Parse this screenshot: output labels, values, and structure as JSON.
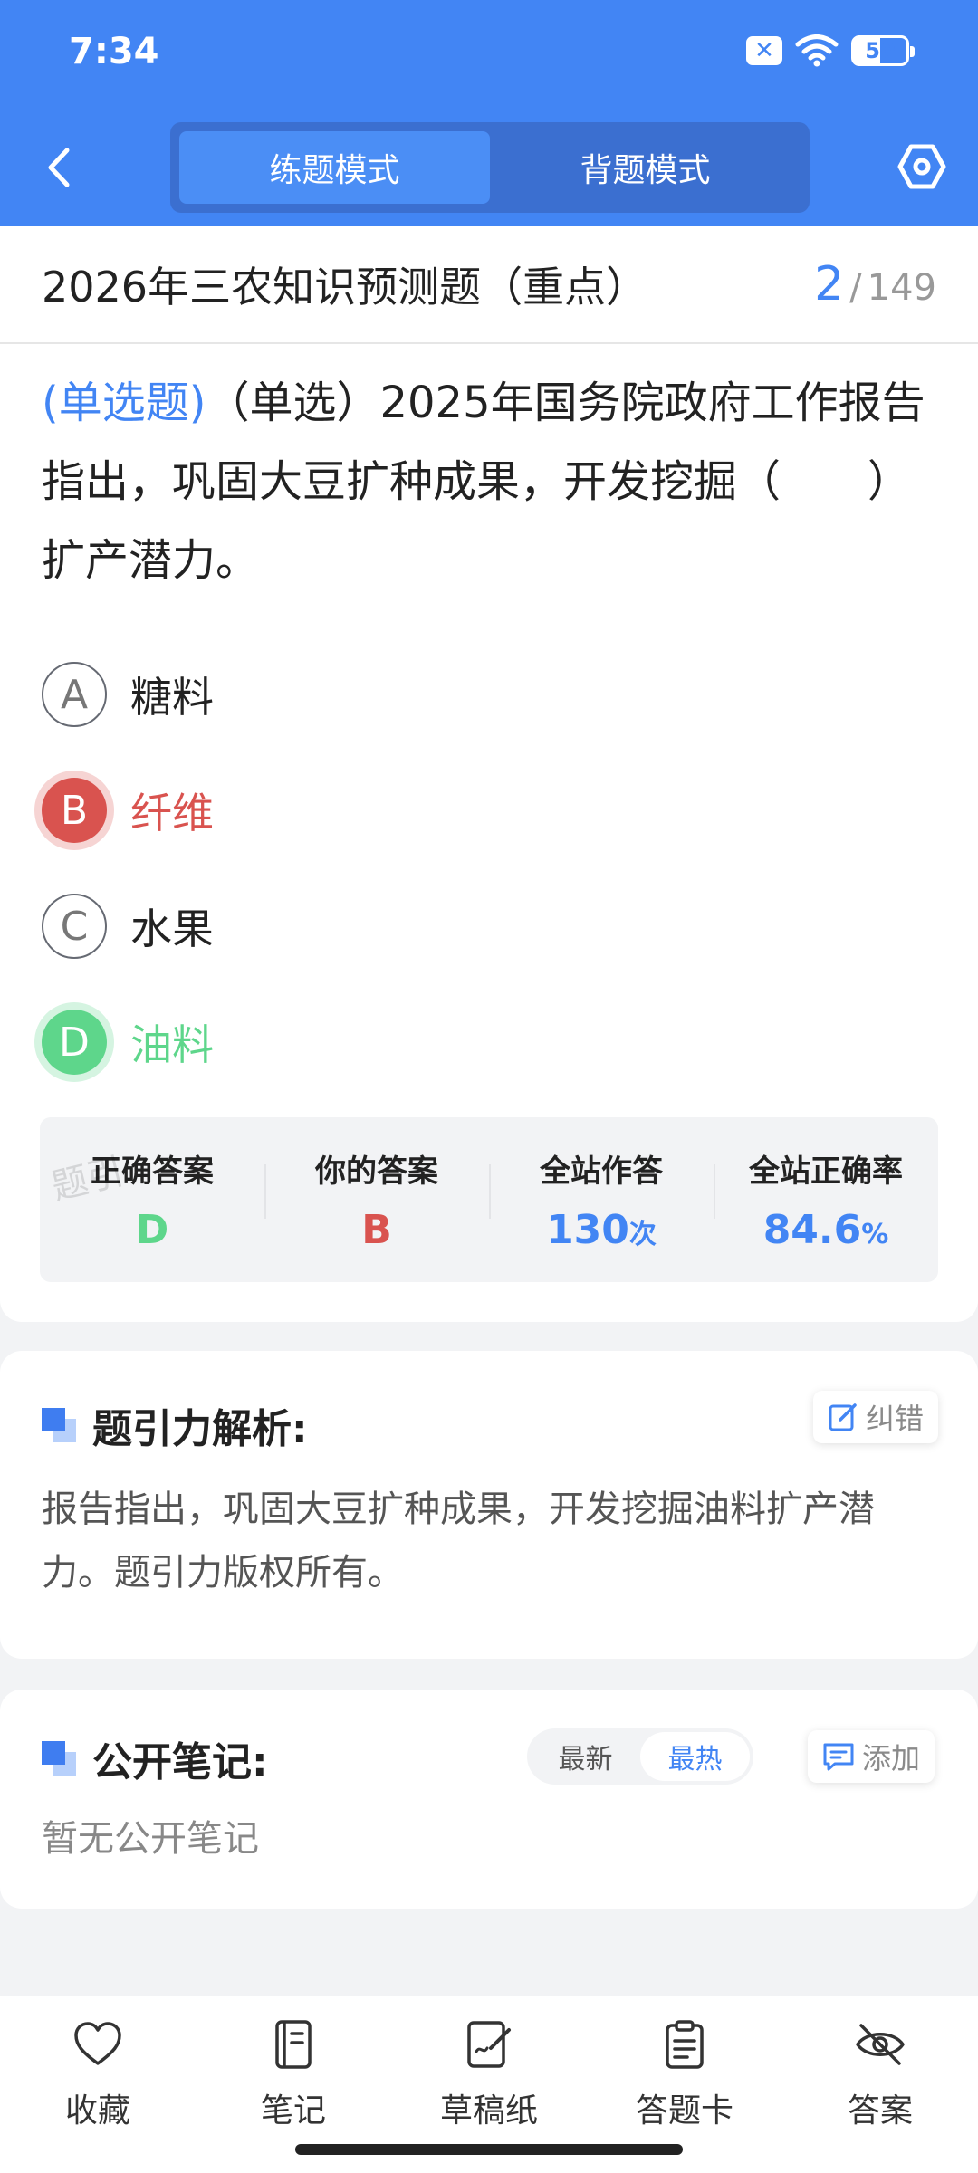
{
  "status_bar": {
    "time": "7:34",
    "battery": "50"
  },
  "header": {
    "modes": [
      {
        "label": "练题模式",
        "active": true
      },
      {
        "label": "背题模式",
        "active": false
      }
    ]
  },
  "exam": {
    "title": "2026年三农知识预测题（重点）",
    "current": "2",
    "separator": "/",
    "total": "149"
  },
  "question": {
    "type_label": "(单选题)",
    "text": "（单选）2025年国务院政府工作报告指出，巩固大豆扩种成果，开发挖掘（　　）扩产潜力。"
  },
  "options": [
    {
      "letter": "A",
      "text": "糖料",
      "state": "normal"
    },
    {
      "letter": "B",
      "text": "纤维",
      "state": "wrong"
    },
    {
      "letter": "C",
      "text": "水果",
      "state": "normal"
    },
    {
      "letter": "D",
      "text": "油料",
      "state": "correct"
    }
  ],
  "stats": {
    "correct_answer": {
      "label": "正确答案",
      "value": "D"
    },
    "your_answer": {
      "label": "你的答案",
      "value": "B"
    },
    "site_answers": {
      "label": "全站作答",
      "value": "130",
      "unit": "次"
    },
    "site_accuracy": {
      "label": "全站正确率",
      "value": "84.6",
      "unit": "%"
    },
    "watermark": "题引"
  },
  "analysis": {
    "title": "题引力解析:",
    "report_label": "纠错",
    "text": "报告指出，巩固大豆扩种成果，开发挖掘油料扩产潜力。题引力版权所有。"
  },
  "notes": {
    "title": "公开笔记:",
    "sort_options": [
      "最新",
      "最热"
    ],
    "active_sort": "最热",
    "add_label": "添加",
    "empty_text": "暂无公开笔记"
  },
  "bottom_bar": {
    "items": [
      {
        "label": "收藏",
        "icon": "heart-icon"
      },
      {
        "label": "笔记",
        "icon": "notebook-icon"
      },
      {
        "label": "草稿纸",
        "icon": "draft-paper-icon"
      },
      {
        "label": "答题卡",
        "icon": "answer-card-icon"
      },
      {
        "label": "答案",
        "icon": "eye-off-icon"
      }
    ]
  },
  "colors": {
    "primary": "#4285f4",
    "wrong": "#d9534f",
    "correct": "#5ed68b"
  }
}
